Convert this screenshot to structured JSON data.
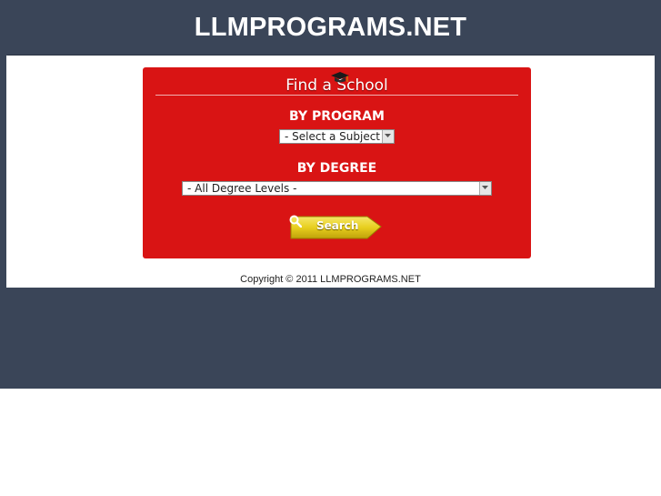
{
  "header": {
    "site_title": "LLMPROGRAMS.NET"
  },
  "search_box": {
    "title": "Find a School",
    "program_label": "BY PROGRAM",
    "subject_select_value": "- Select a Subject -",
    "degree_label": "BY DEGREE",
    "degree_select_value": "- All Degree Levels -",
    "search_button_label": "Search"
  },
  "footer": {
    "copyright": "Copyright © 2011 LLMPROGRAMS.NET"
  },
  "colors": {
    "header_bg": "#3a4558",
    "box_red": "#d91414",
    "button_yellow": "#e8cf1e"
  },
  "icons": {
    "title_icon": "graduation-cap-icon",
    "button_icon": "search-icon"
  }
}
